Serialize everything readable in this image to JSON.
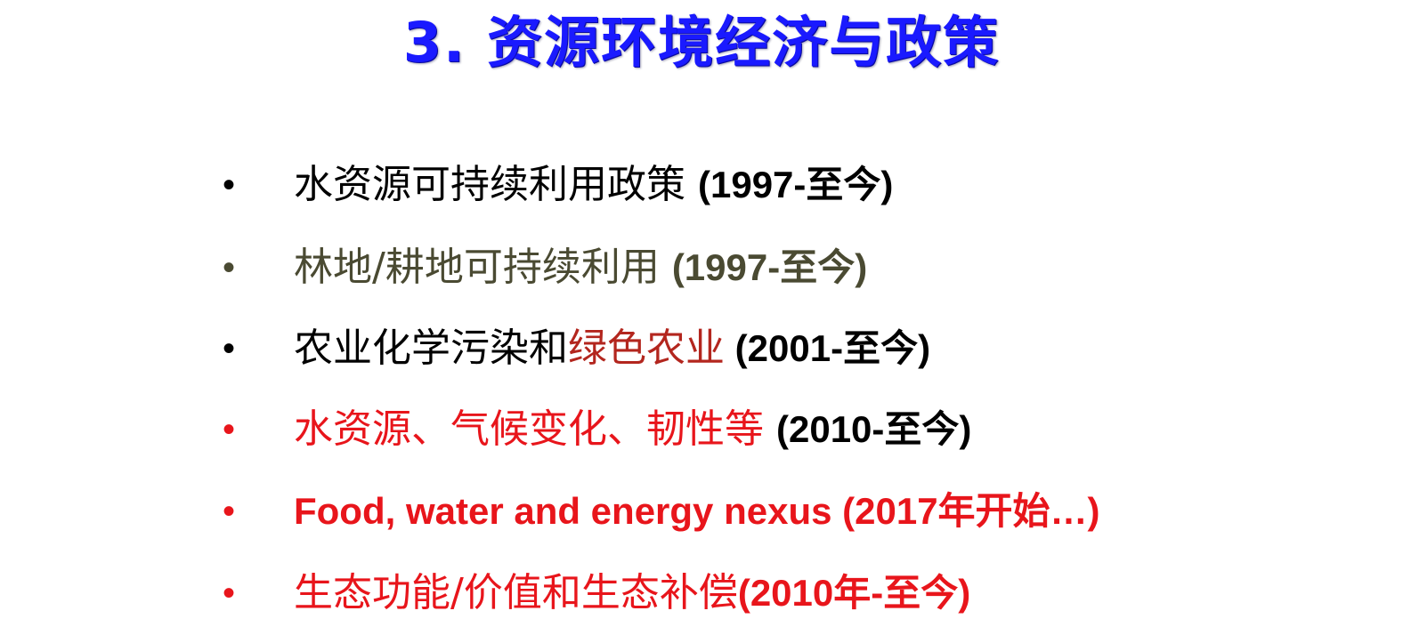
{
  "slide": {
    "title": "3. 资源环境经济与政策"
  },
  "colors": {
    "title": "#1a1aff",
    "black": "#000000",
    "olive": "#4a4a32",
    "red": "#e8151b",
    "dark_red": "#b3261e"
  },
  "bullets": [
    {
      "bullet": "•",
      "main": "水资源可持续利用政策 ",
      "accent": "",
      "years": "(1997-至今)"
    },
    {
      "bullet": "•",
      "main": "林地/耕地可持续利用 ",
      "accent": "",
      "years": "(1997-至今)"
    },
    {
      "bullet": "•",
      "main": "农业化学污染和",
      "accent": "绿色农业",
      "years": " (2001-至今)"
    },
    {
      "bullet": "•",
      "main": "水资源、气候变化、韧性等 ",
      "accent": "",
      "years": "(2010-至今)"
    },
    {
      "bullet": "•",
      "main": "Food, water and energy nexus ",
      "accent": "",
      "years": "(2017年开始…)"
    },
    {
      "bullet": "•",
      "main": "生态功能/价值和生态补偿",
      "accent": "",
      "years": "(2010年-至今)"
    }
  ]
}
